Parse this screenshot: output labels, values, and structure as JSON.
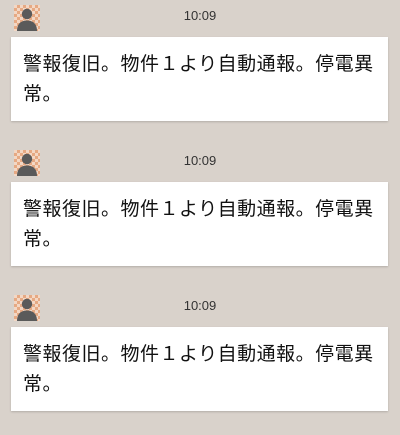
{
  "messages": [
    {
      "time": "10:09",
      "text": "警報復旧。物件１より自動通報。停電異常。",
      "avatar_icon": "person-icon"
    },
    {
      "time": "10:09",
      "text": "警報復旧。物件１より自動通報。停電異常。",
      "avatar_icon": "person-icon"
    },
    {
      "time": "10:09",
      "text": "警報復旧。物件１より自動通報。停電異常。",
      "avatar_icon": "person-icon"
    }
  ],
  "colors": {
    "background": "#d9d2cb",
    "bubble": "#ffffff",
    "avatar_pattern": "#e6a983",
    "avatar_silhouette": "#5a5a5a"
  }
}
